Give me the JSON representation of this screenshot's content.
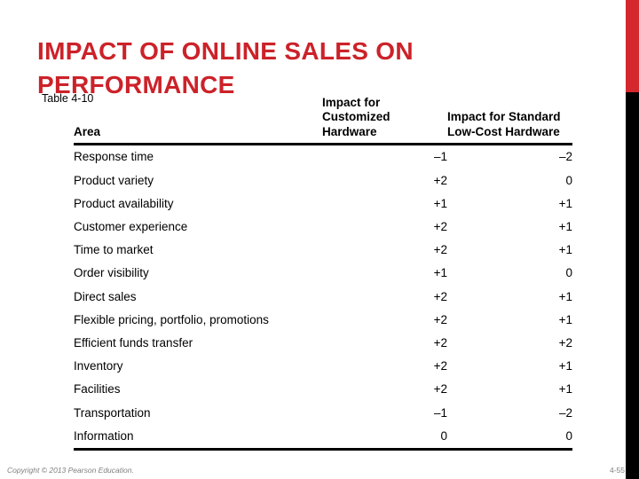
{
  "slide": {
    "title": "IMPACT OF ONLINE SALES ON PERFORMANCE",
    "accent_color": "#cc2229",
    "bar_red_color": "#d5282e",
    "bar_black_color": "#000000"
  },
  "table": {
    "caption": "Table 4-10",
    "columns": [
      {
        "label": "Area"
      },
      {
        "label": "Impact for Customized Hardware"
      },
      {
        "label": "Impact for Standard Low-Cost Hardware"
      }
    ],
    "rows": [
      {
        "area": "Response time",
        "customized": "–1",
        "standard": "–2"
      },
      {
        "area": "Product variety",
        "customized": "+2",
        "standard": "0"
      },
      {
        "area": "Product availability",
        "customized": "+1",
        "standard": "+1"
      },
      {
        "area": "Customer experience",
        "customized": "+2",
        "standard": "+1"
      },
      {
        "area": "Time to market",
        "customized": "+2",
        "standard": "+1"
      },
      {
        "area": "Order visibility",
        "customized": "+1",
        "standard": "0"
      },
      {
        "area": "Direct sales",
        "customized": "+2",
        "standard": "+1"
      },
      {
        "area": "Flexible pricing, portfolio, promotions",
        "customized": "+2",
        "standard": "+1"
      },
      {
        "area": "Efficient funds transfer",
        "customized": "+2",
        "standard": "+2"
      },
      {
        "area": "Inventory",
        "customized": "+2",
        "standard": "+1"
      },
      {
        "area": "Facilities",
        "customized": "+2",
        "standard": "+1"
      },
      {
        "area": "Transportation",
        "customized": "–1",
        "standard": "–2"
      },
      {
        "area": "Information",
        "customized": "0",
        "standard": "0"
      }
    ]
  },
  "footer": {
    "copyright": "Copyright © 2013 Pearson Education.",
    "page_number": "4-55"
  }
}
